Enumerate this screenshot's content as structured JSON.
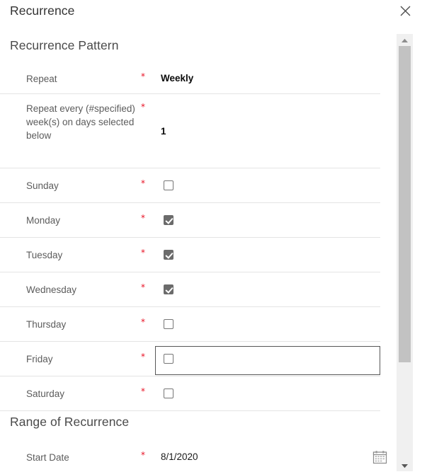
{
  "dialog": {
    "title": "Recurrence",
    "close_label": "Close",
    "close_icon": "close-icon"
  },
  "sections": [
    {
      "id": "pattern",
      "heading": "Recurrence Pattern"
    },
    {
      "id": "range",
      "heading": "Range of Recurrence"
    }
  ],
  "required_marker": "*",
  "fields": {
    "repeat": {
      "label": "Repeat",
      "value": "Weekly",
      "required": true
    },
    "repeat_every": {
      "label": "Repeat every (#specified) week(s) on days selected below",
      "value": "1",
      "required": true
    },
    "sunday": {
      "label": "Sunday",
      "checked": false,
      "required": true
    },
    "monday": {
      "label": "Monday",
      "checked": true,
      "required": true
    },
    "tuesday": {
      "label": "Tuesday",
      "checked": true,
      "required": true
    },
    "wednesday": {
      "label": "Wednesday",
      "checked": true,
      "required": true
    },
    "thursday": {
      "label": "Thursday",
      "checked": false,
      "required": true
    },
    "friday": {
      "label": "Friday",
      "checked": false,
      "required": true,
      "focused": true
    },
    "saturday": {
      "label": "Saturday",
      "checked": false,
      "required": true
    },
    "start_date": {
      "label": "Start Date",
      "value": "8/1/2020",
      "required": true,
      "icon": "calendar-icon"
    }
  },
  "scrollbar": {
    "up_icon": "triangle-up-icon",
    "down_icon": "triangle-down-icon",
    "thumb": "scroll-thumb"
  },
  "colors": {
    "required_red": "#e81123",
    "checkbox_checked": "#6b6b6b",
    "divider": "#e4e4e4",
    "scroll_thumb": "#c2c2c2",
    "focus_border": "#575757"
  }
}
